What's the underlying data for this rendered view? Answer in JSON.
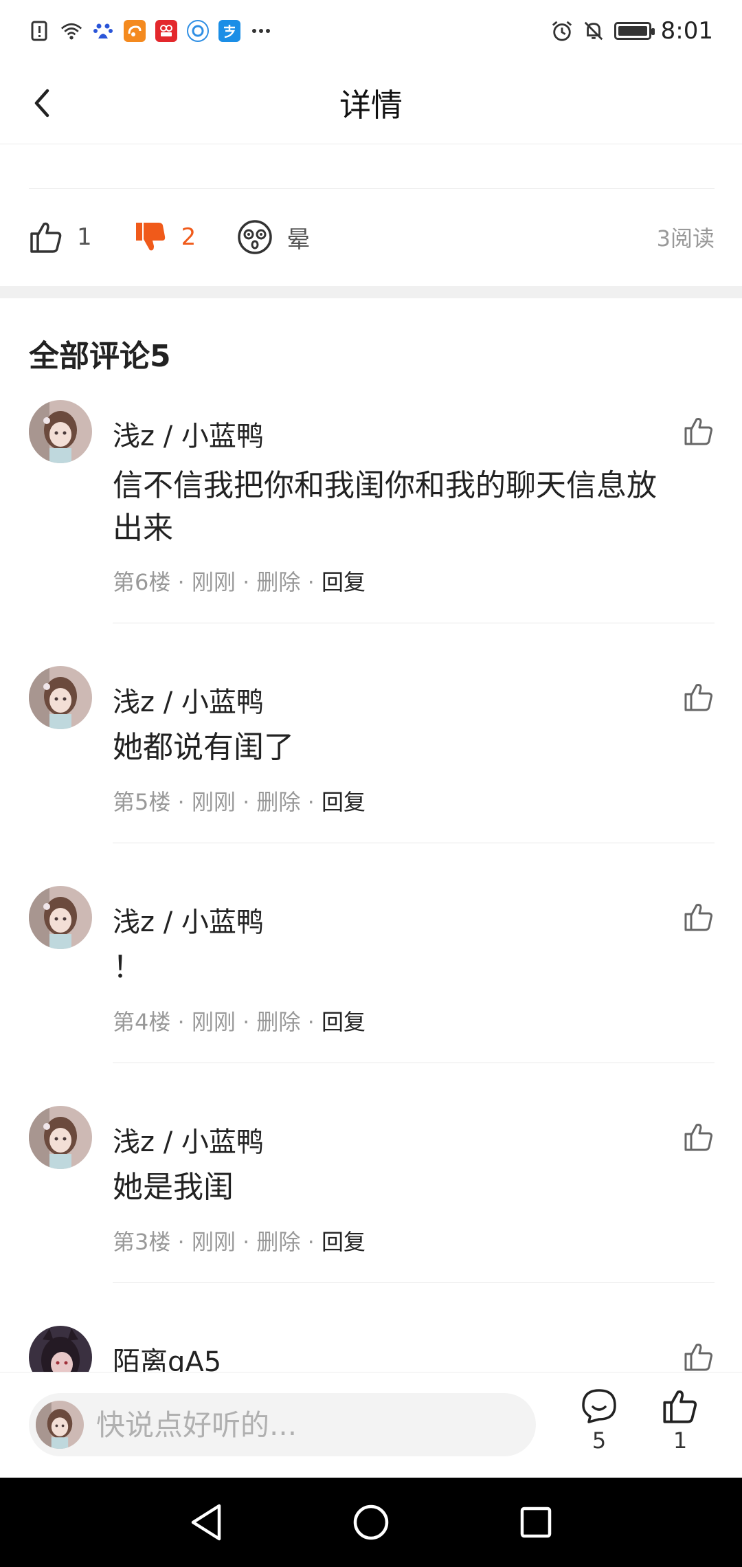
{
  "status_bar": {
    "time": "8:01",
    "left_icons": [
      "alert-icon",
      "wifi-icon",
      "baidu-icon",
      "uc-browser-icon",
      "recorder-icon",
      "qq-browser-icon",
      "alipay-icon",
      "more-dots-icon"
    ],
    "right_icons": [
      "alarm-icon",
      "mute-icon",
      "battery-icon"
    ]
  },
  "header": {
    "title": "详情"
  },
  "reactions": {
    "like_count": "1",
    "dislike_count": "2",
    "dizzy_label": "晕",
    "read_count": "3阅读",
    "accent_color": "#f05a1a"
  },
  "comments": {
    "title": "全部评论5",
    "items": [
      {
        "name": "浅z / 小蓝鸭",
        "text": "信不信我把你和我闺你和我的聊天信息放出来",
        "floor": "第6楼",
        "time": "刚刚",
        "delete": "删除",
        "reply": "回复"
      },
      {
        "name": "浅z / 小蓝鸭",
        "text": "她都说有闺了",
        "floor": "第5楼",
        "time": "刚刚",
        "delete": "删除",
        "reply": "回复"
      },
      {
        "name": "浅z / 小蓝鸭",
        "text": "！",
        "floor": "第4楼",
        "time": "刚刚",
        "delete": "删除",
        "reply": "回复"
      },
      {
        "name": "浅z / 小蓝鸭",
        "text": "她是我闺",
        "floor": "第3楼",
        "time": "刚刚",
        "delete": "删除",
        "reply": "回复"
      },
      {
        "name": "陌离gA5"
      }
    ]
  },
  "bottom_bar": {
    "input_placeholder": "快说点好听的...",
    "comment_count": "5",
    "like_count": "1"
  },
  "separator": " · "
}
